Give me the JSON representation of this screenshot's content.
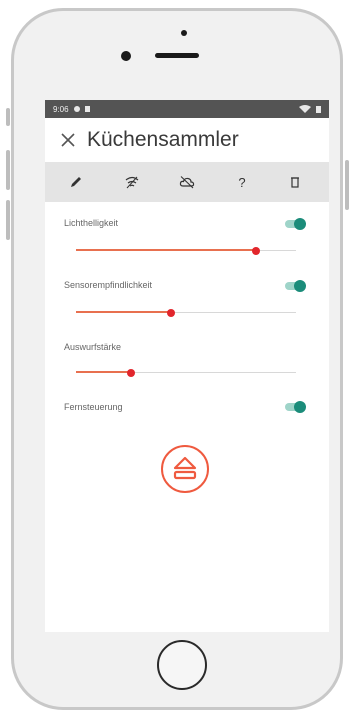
{
  "status_bar": {
    "time": "9:06",
    "signal_icon": "wifi-signal-icon",
    "battery_icon": "battery-icon"
  },
  "header": {
    "close_icon": "close-icon",
    "title": "Küchensammler"
  },
  "toolbar": {
    "items": [
      {
        "icon": "pencil-icon"
      },
      {
        "icon": "wifi-icon"
      },
      {
        "icon": "cloud-off-icon"
      },
      {
        "icon": "help-icon",
        "label": "?"
      },
      {
        "icon": "trash-icon"
      }
    ]
  },
  "settings": {
    "brightness": {
      "label": "Lichthelligkeit",
      "enabled": true,
      "level": 0.82
    },
    "sensitivity": {
      "label": "Sensorempfindlichkeit",
      "enabled": true,
      "level": 0.43
    },
    "eject_strength": {
      "label": "Auswurfstärke",
      "level": 0.25
    },
    "remote": {
      "label": "Fernsteuerung",
      "enabled": true
    }
  },
  "action": {
    "icon": "eject-icon"
  },
  "colors": {
    "accent": "#ef5a3f",
    "toggle_on": "#1b8c7a",
    "toolbar_bg": "#e4e4e4",
    "status_bar_bg": "#545454"
  }
}
